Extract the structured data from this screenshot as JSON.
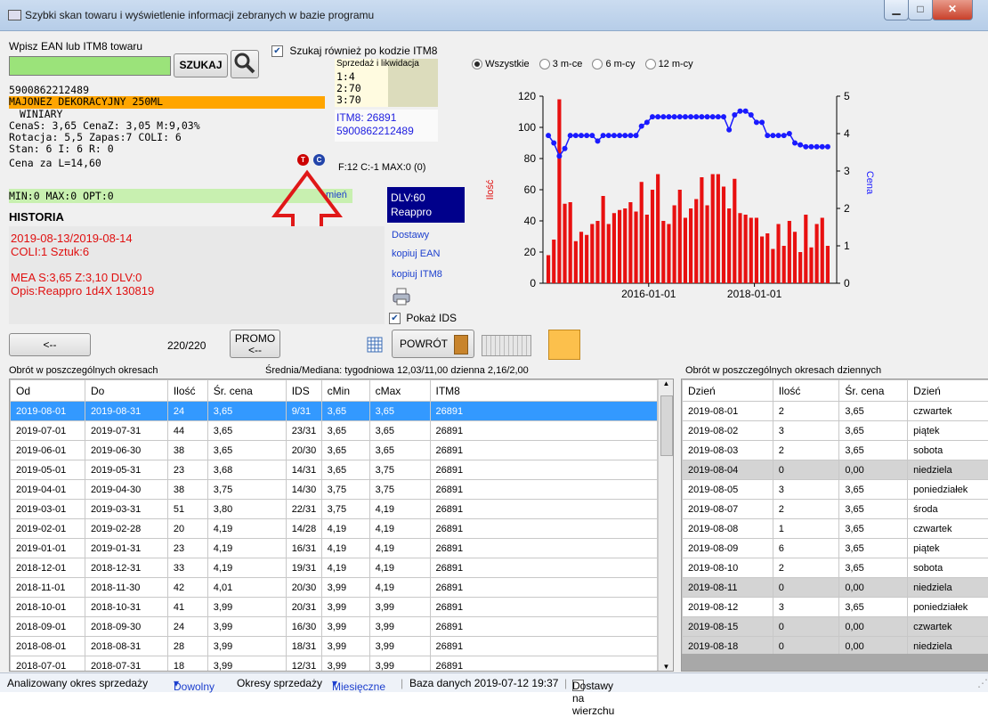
{
  "window": {
    "title": "Szybki skan towaru i wyświetlenie informacji zebranych w bazie programu"
  },
  "search": {
    "label": "Wpisz EAN lub ITM8 towaru",
    "value": "",
    "button": "SZUKAJ",
    "itm8_checkbox": "Szukaj również po kodzie ITM8",
    "itm8_checked": true
  },
  "product": {
    "ean": "5900862212489",
    "name": "MAJONEZ DEKORACYJNY 250ML",
    "brand": "WINIARY",
    "line1": "CenaS: 3,65  CenaZ: 3,05  M:9,03%",
    "line2": "Rotacja: 5,5  Zapas:7  COLI: 6",
    "line3": "Stan: 6  I: 6  R: 0",
    "line4": "Cena za L=14,60"
  },
  "sales_box": {
    "title": "Sprzedaż i likwidacja",
    "rows": [
      "1:4",
      "2:70",
      "3:70"
    ]
  },
  "itm_info": {
    "itm": "ITM8: 26891",
    "ean": "5900862212489"
  },
  "fc": "F:12 C:-1 MAX:0 (0)",
  "minmax": {
    "text": "MIN:0 MAX:0 OPT:0",
    "link": "mień"
  },
  "historia": {
    "title": "HISTORIA",
    "line1": "2019-08-13/2019-08-14",
    "line2": "COLI:1  Sztuk:6",
    "line3": "MEA S:3,65  Z:3,10  DLV:0",
    "line4": "Opis:Reappro 1d4X 130819"
  },
  "dlv": {
    "line1": "DLV:60",
    "line2": "Reappro"
  },
  "links": {
    "dostawy": "Dostawy",
    "kopiuj_ean": "kopiuj EAN",
    "kopiuj_itm": "kopiuj ITM8"
  },
  "pokaz_ids": {
    "label": "Pokaż IDS",
    "checked": true
  },
  "period": {
    "options": [
      "Wszystkie",
      "3 m-ce",
      "6 m-cy",
      "12 m-cy"
    ],
    "selected": "Wszystkie"
  },
  "controls": {
    "back": "<--",
    "pager": "220/220",
    "promo": "PROMO",
    "promo_arrow": "<--",
    "powrot": "POWRÓT"
  },
  "left_table": {
    "caption": "Obrót w poszczególnych okresach",
    "stats": "Średnia/Mediana: tygodniowa 12,03/11,00  dzienna 2,16/2,00",
    "headers": [
      "Od",
      "Do",
      "Ilość",
      "Śr. cena",
      "IDS",
      "cMin",
      "cMax",
      "ITM8"
    ],
    "rows": [
      [
        "2019-08-01",
        "2019-08-31",
        "24",
        "3,65",
        "9/31",
        "3,65",
        "3,65",
        "26891"
      ],
      [
        "2019-07-01",
        "2019-07-31",
        "44",
        "3,65",
        "23/31",
        "3,65",
        "3,65",
        "26891"
      ],
      [
        "2019-06-01",
        "2019-06-30",
        "38",
        "3,65",
        "20/30",
        "3,65",
        "3,65",
        "26891"
      ],
      [
        "2019-05-01",
        "2019-05-31",
        "23",
        "3,68",
        "14/31",
        "3,65",
        "3,75",
        "26891"
      ],
      [
        "2019-04-01",
        "2019-04-30",
        "38",
        "3,75",
        "14/30",
        "3,75",
        "3,75",
        "26891"
      ],
      [
        "2019-03-01",
        "2019-03-31",
        "51",
        "3,80",
        "22/31",
        "3,75",
        "4,19",
        "26891"
      ],
      [
        "2019-02-01",
        "2019-02-28",
        "20",
        "4,19",
        "14/28",
        "4,19",
        "4,19",
        "26891"
      ],
      [
        "2019-01-01",
        "2019-01-31",
        "23",
        "4,19",
        "16/31",
        "4,19",
        "4,19",
        "26891"
      ],
      [
        "2018-12-01",
        "2018-12-31",
        "33",
        "4,19",
        "19/31",
        "4,19",
        "4,19",
        "26891"
      ],
      [
        "2018-11-01",
        "2018-11-30",
        "42",
        "4,01",
        "20/30",
        "3,99",
        "4,19",
        "26891"
      ],
      [
        "2018-10-01",
        "2018-10-31",
        "41",
        "3,99",
        "20/31",
        "3,99",
        "3,99",
        "26891"
      ],
      [
        "2018-09-01",
        "2018-09-30",
        "24",
        "3,99",
        "16/30",
        "3,99",
        "3,99",
        "26891"
      ],
      [
        "2018-08-01",
        "2018-08-31",
        "28",
        "3,99",
        "18/31",
        "3,99",
        "3,99",
        "26891"
      ],
      [
        "2018-07-01",
        "2018-07-31",
        "18",
        "3,99",
        "12/31",
        "3,99",
        "3,99",
        "26891"
      ]
    ]
  },
  "right_table": {
    "caption": "Obrót w poszczególnych okresach dziennych",
    "headers": [
      "Dzień",
      "Ilość",
      "Śr. cena",
      "Dzień"
    ],
    "rows": [
      [
        "2019-08-01",
        "2",
        "3,65",
        "czwartek"
      ],
      [
        "2019-08-02",
        "3",
        "3,65",
        "piątek"
      ],
      [
        "2019-08-03",
        "2",
        "3,65",
        "sobota"
      ],
      [
        "2019-08-04",
        "0",
        "0,00",
        "niedziela"
      ],
      [
        "2019-08-05",
        "3",
        "3,65",
        "poniedziałek"
      ],
      [
        "2019-08-07",
        "2",
        "3,65",
        "środa"
      ],
      [
        "2019-08-08",
        "1",
        "3,65",
        "czwartek"
      ],
      [
        "2019-08-09",
        "6",
        "3,65",
        "piątek"
      ],
      [
        "2019-08-10",
        "2",
        "3,65",
        "sobota"
      ],
      [
        "2019-08-11",
        "0",
        "0,00",
        "niedziela"
      ],
      [
        "2019-08-12",
        "3",
        "3,65",
        "poniedziałek"
      ],
      [
        "2019-08-15",
        "0",
        "0,00",
        "czwartek"
      ],
      [
        "2019-08-18",
        "0",
        "0,00",
        "niedziela"
      ]
    ]
  },
  "status": {
    "label1": "Analizowany okres sprzedaży",
    "val1": "Dowolny",
    "label2": "Okresy sprzedaży",
    "val2": "Miesięczne",
    "db": "Baza danych 2019-07-12 19:37",
    "dostawy": "Dostawy na wierzchu"
  },
  "colors": {
    "accent_green": "#9be37a",
    "orange": "#ffa500",
    "red": "#e81010",
    "blue": "#1a1aff",
    "select": "#3399ff",
    "dlv_bg": "#00008b"
  },
  "chart_data": {
    "type": "bar",
    "ylabel": "Ilość",
    "y2label": "Cena",
    "ylim": [
      0,
      120
    ],
    "y2lim": [
      0,
      5
    ],
    "yticks": [
      0,
      20,
      40,
      60,
      80,
      100,
      120
    ],
    "y2ticks": [
      0,
      1,
      2,
      3,
      4,
      5
    ],
    "xticks": [
      "2016-01-01",
      "2018-01-01"
    ],
    "series": [
      {
        "values": [
          18,
          28,
          118,
          51,
          52,
          27,
          33,
          31,
          38,
          40,
          56,
          38,
          45,
          47,
          48,
          52,
          46,
          65,
          44,
          60,
          70,
          40,
          38,
          50,
          60,
          42,
          48,
          54,
          68,
          50,
          70,
          70,
          62,
          48,
          67,
          45,
          44,
          42,
          42,
          30,
          32,
          22,
          38,
          24,
          40,
          33,
          20,
          44,
          23,
          38,
          42,
          24
        ]
      },
      {
        "values": [
          3.95,
          3.75,
          3.4,
          3.6,
          3.95,
          3.95,
          3.95,
          3.95,
          3.95,
          3.8,
          3.95,
          3.95,
          3.95,
          3.95,
          3.95,
          3.95,
          3.95,
          4.2,
          4.3,
          4.45,
          4.45,
          4.45,
          4.45,
          4.45,
          4.45,
          4.45,
          4.45,
          4.45,
          4.45,
          4.45,
          4.45,
          4.45,
          4.45,
          4.1,
          4.5,
          4.6,
          4.6,
          4.5,
          4.3,
          4.3,
          3.95,
          3.95,
          3.95,
          3.95,
          4.0,
          3.75,
          3.7,
          3.65,
          3.65,
          3.65,
          3.65,
          3.65
        ]
      }
    ]
  }
}
